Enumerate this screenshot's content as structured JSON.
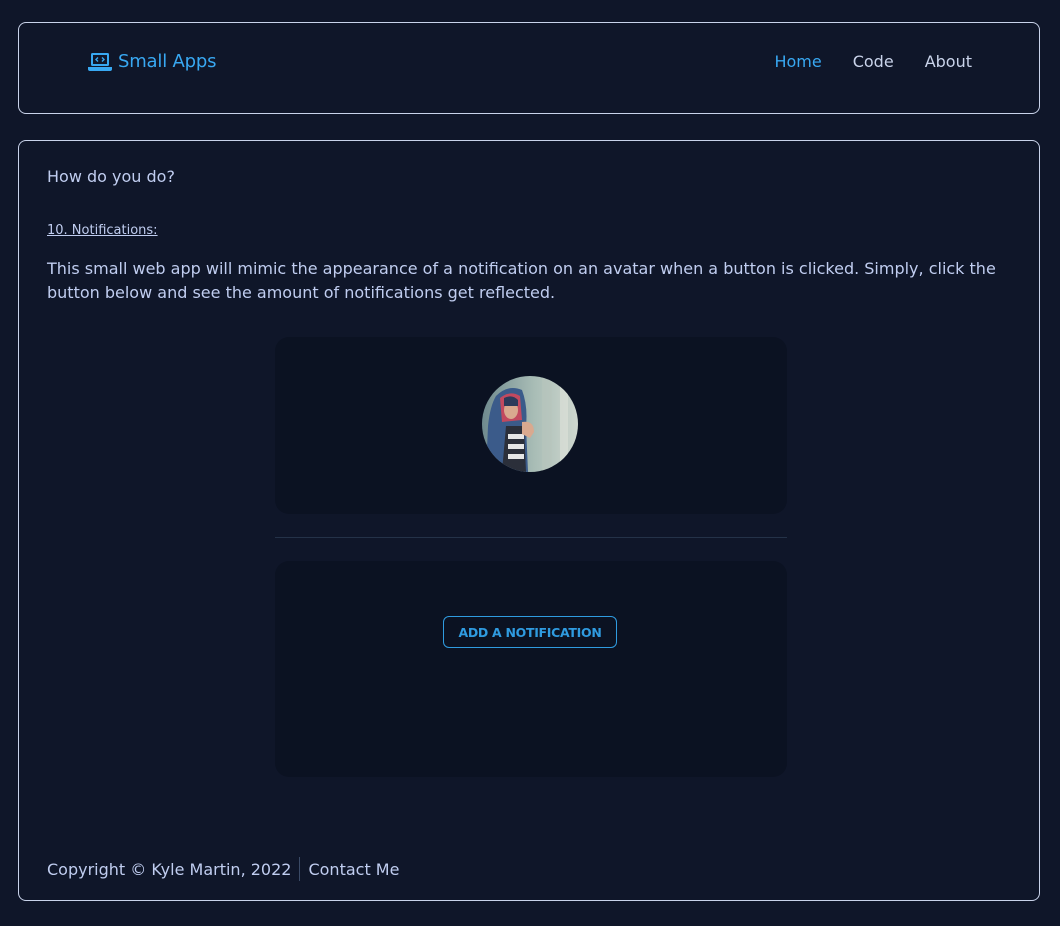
{
  "header": {
    "brand": "Small Apps",
    "nav": {
      "home": "Home",
      "code": "Code",
      "about": "About"
    }
  },
  "main": {
    "greeting": "How do you do?",
    "section_title": "10. Notifications:",
    "description": "This small web app will mimic the appearance of a notification on an avatar when a button is clicked. Simply, click the button below and see the amount of notifications get reflected.",
    "button_label": "ADD A NOTIFICATION"
  },
  "footer": {
    "copyright": "Copyright © Kyle Martin, 2022",
    "contact": "Contact Me"
  },
  "colors": {
    "background": "#0f1629",
    "accent": "#38a8f2",
    "text": "#c0cdf0",
    "panel": "#0b1222"
  }
}
